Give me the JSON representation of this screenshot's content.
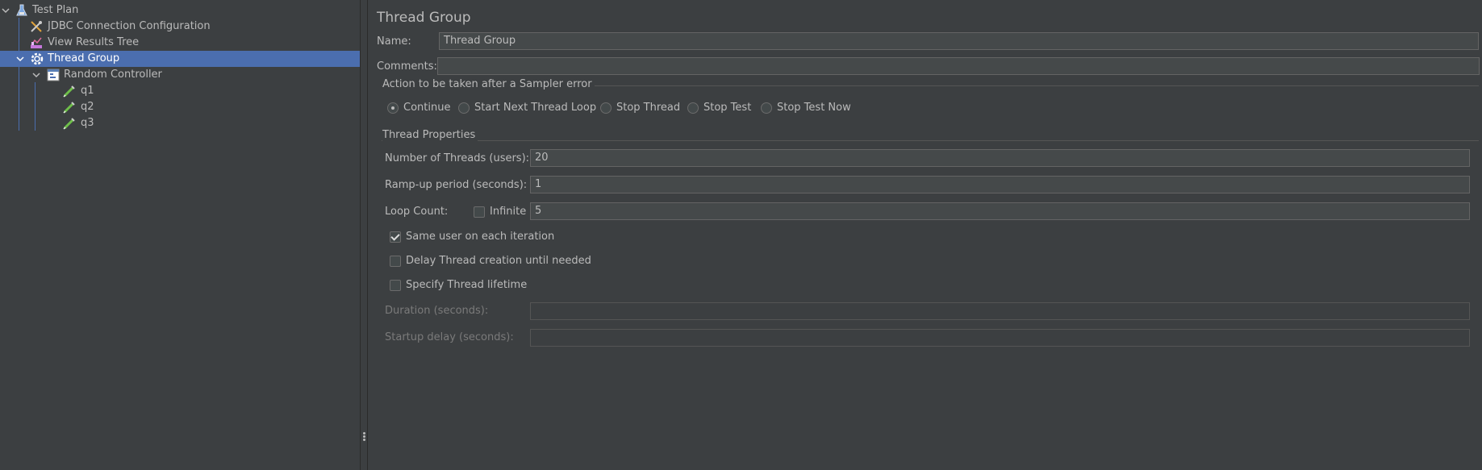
{
  "tree": {
    "items": [
      {
        "label": "Test Plan",
        "icon": "flask-icon"
      },
      {
        "label": "JDBC Connection Configuration",
        "icon": "tools-icon"
      },
      {
        "label": "View Results Tree",
        "icon": "chart-icon"
      },
      {
        "label": "Thread Group",
        "icon": "gear-icon"
      },
      {
        "label": "Random Controller",
        "icon": "controller-icon"
      },
      {
        "label": "q1",
        "icon": "sampler-icon"
      },
      {
        "label": "q2",
        "icon": "sampler-icon"
      },
      {
        "label": "q3",
        "icon": "sampler-icon"
      }
    ]
  },
  "panel": {
    "title": "Thread Group",
    "name_label": "Name:",
    "name_value": "Thread Group",
    "comments_label": "Comments:",
    "comments_value": "",
    "error_group": {
      "title": "Action to be taken after a Sampler error",
      "options": [
        "Continue",
        "Start Next Thread Loop",
        "Stop Thread",
        "Stop Test",
        "Stop Test Now"
      ],
      "selected": "Continue"
    },
    "thread_props": {
      "title": "Thread Properties",
      "threads_label": "Number of Threads (users):",
      "threads_value": "20",
      "rampup_label": "Ramp-up period (seconds):",
      "rampup_value": "1",
      "loop_label": "Loop Count:",
      "infinite_label": "Infinite",
      "loop_value": "5",
      "same_user_label": "Same user on each iteration",
      "delay_label": "Delay Thread creation until needed",
      "lifetime_label": "Specify Thread lifetime",
      "duration_label": "Duration (seconds):",
      "startup_label": "Startup delay (seconds):"
    }
  }
}
